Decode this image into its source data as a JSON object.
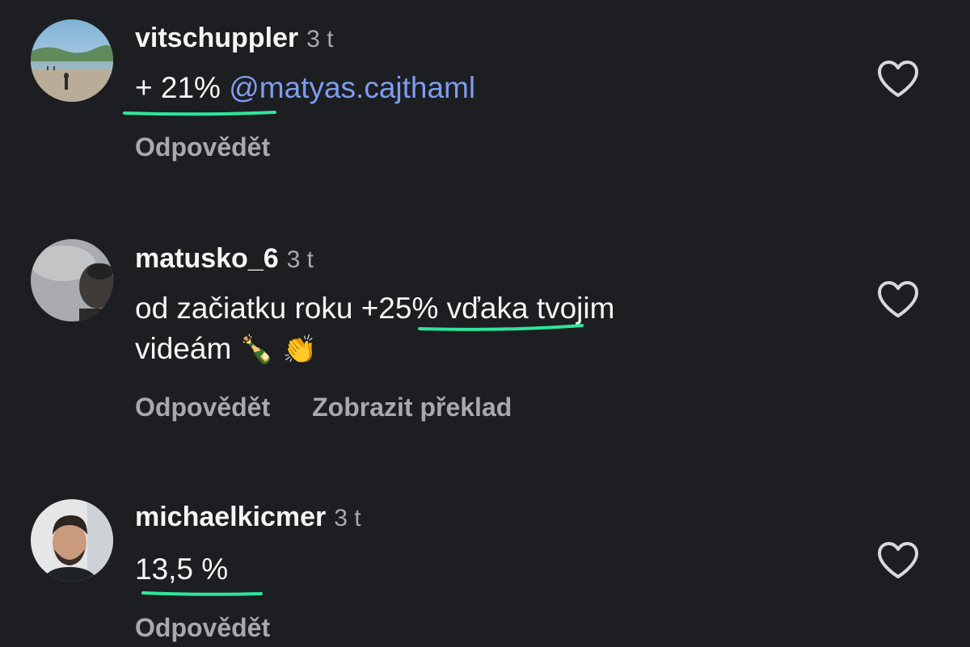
{
  "comments": [
    {
      "username": "vitschuppler",
      "time": "3 t",
      "text_before": "+ 21% ",
      "mention": "@matyas.cajthaml",
      "reply_label": "Odpovědět"
    },
    {
      "username": "matusko_6",
      "time": "3 t",
      "line1": "od začiatku roku +25% vďaka tvojim",
      "line2": "videám",
      "emoji": "🍾 👏",
      "reply_label": "Odpovědět",
      "translate_label": "Zobrazit překlad"
    },
    {
      "username": "michaelkicmer",
      "time": "3 t",
      "text": "13,5 %",
      "reply_label": "Odpovědět"
    }
  ],
  "colors": {
    "background": "#1d1e21",
    "text": "#f5f5f5",
    "secondary": "#a8a8ad",
    "mention": "#7e9cf0",
    "highlight_underline": "#2ee59d"
  },
  "icons": {
    "like": "heart-outline-icon"
  }
}
